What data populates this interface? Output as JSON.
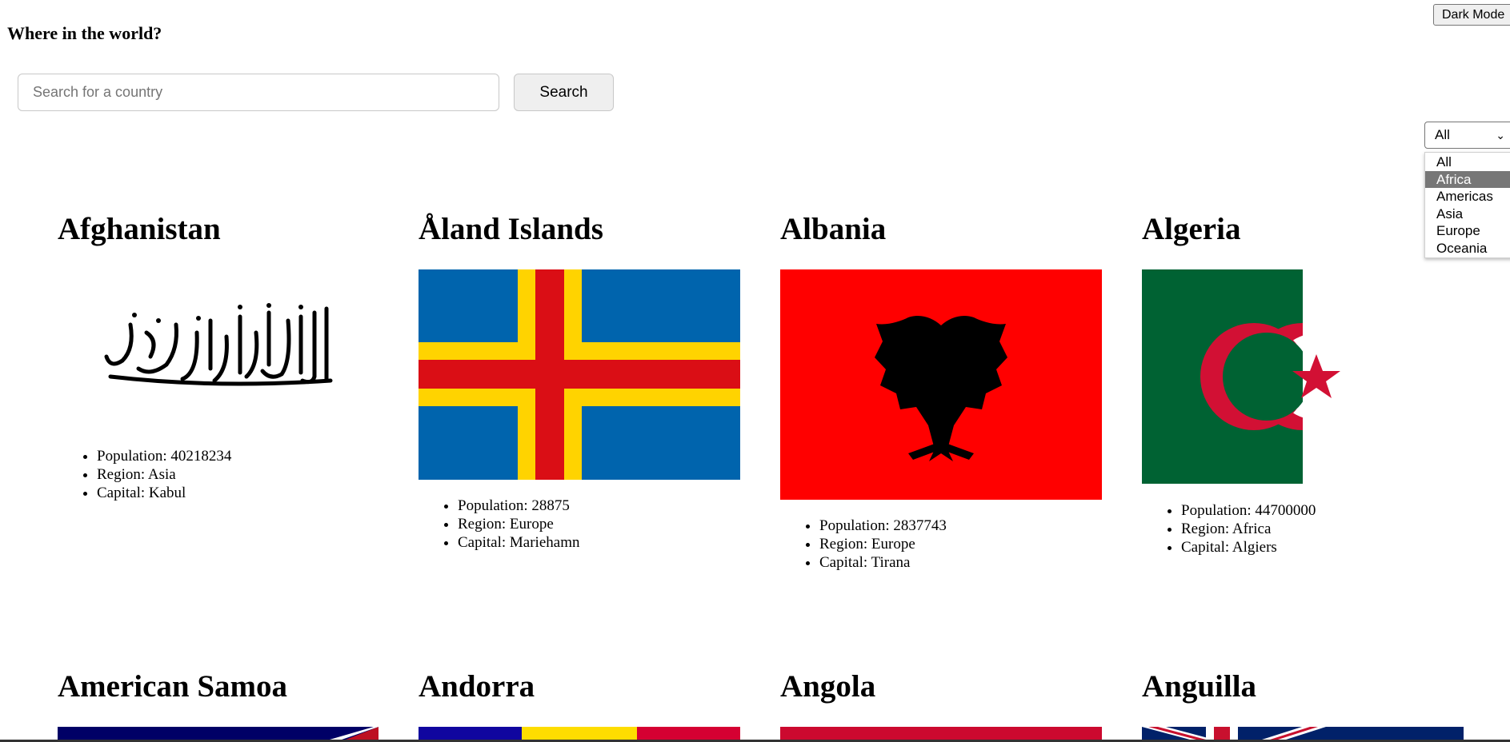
{
  "header": {
    "title": "Where in the world?",
    "dark_mode_label": "Dark Mode"
  },
  "search": {
    "placeholder": "Search for a country",
    "value": "",
    "button_label": "Search"
  },
  "filter": {
    "selected": "All",
    "options": [
      "All",
      "Africa",
      "Americas",
      "Asia",
      "Europe",
      "Oceania"
    ],
    "highlighted": "Africa"
  },
  "labels": {
    "population": "Population: ",
    "region": "Region: ",
    "capital": "Capital: "
  },
  "countries": [
    {
      "name": "Afghanistan",
      "population": "40218234",
      "region": "Asia",
      "capital": "Kabul",
      "flag": "afghanistan-flag"
    },
    {
      "name": "Åland Islands",
      "population": "28875",
      "region": "Europe",
      "capital": "Mariehamn",
      "flag": "aland-islands-flag"
    },
    {
      "name": "Albania",
      "population": "2837743",
      "region": "Europe",
      "capital": "Tirana",
      "flag": "albania-flag"
    },
    {
      "name": "Algeria",
      "population": "44700000",
      "region": "Africa",
      "capital": "Algiers",
      "flag": "algeria-flag"
    },
    {
      "name": "American Samoa",
      "flag": "american-samoa-flag"
    },
    {
      "name": "Andorra",
      "flag": "andorra-flag"
    },
    {
      "name": "Angola",
      "flag": "angola-flag"
    },
    {
      "name": "Anguilla",
      "flag": "anguilla-flag"
    }
  ],
  "colors": {
    "aland_blue": "#0064AD",
    "aland_yellow": "#FFD300",
    "aland_red": "#DA0E15",
    "albania_red": "#FF0000",
    "algeria_green": "#006233",
    "algeria_red": "#D21034",
    "samoa_navy": "#000066",
    "andorra_blue": "#10069F",
    "andorra_yellow": "#FEDD00",
    "andorra_red": "#D50032",
    "angola_red": "#CC092F",
    "uk_navy": "#012169"
  }
}
